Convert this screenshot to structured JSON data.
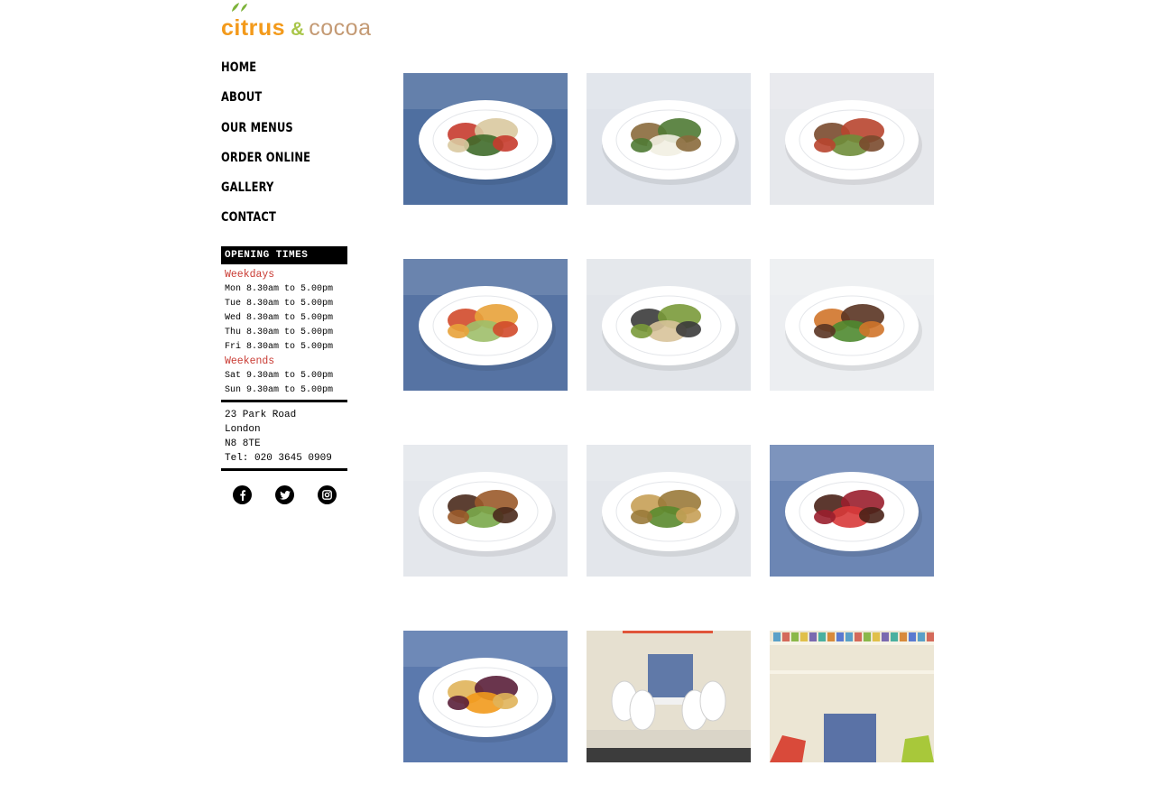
{
  "brand": {
    "part1": "citrus",
    "amp": "&",
    "part2": "cocoa",
    "colors": {
      "citrus": "#f39a1b",
      "amp": "#a9c64a",
      "cocoa": "#c49a74"
    }
  },
  "nav": {
    "items": [
      {
        "label": "HOME"
      },
      {
        "label": "ABOUT"
      },
      {
        "label": "OUR MENUS"
      },
      {
        "label": "ORDER ONLINE"
      },
      {
        "label": "GALLERY"
      },
      {
        "label": "CONTACT"
      }
    ]
  },
  "opening_times": {
    "title": "OPENING TIMES",
    "weekdays_label": "Weekdays",
    "weekdays": [
      "Mon 8.30am to 5.00pm",
      "Tue 8.30am to 5.00pm",
      "Wed 8.30am to 5.00pm",
      "Thu 8.30am to 5.00pm",
      "Fri 8.30am to 5.00pm"
    ],
    "weekends_label": "Weekends",
    "weekends": [
      "Sat 9.30am to 5.00pm",
      "Sun 9.30am to 5.00pm"
    ],
    "accent_color": "#c93a32"
  },
  "address": {
    "line1": "23 Park Road",
    "line2": "London",
    "line3": "N8 8TE",
    "tel": "Tel: 020 3645 0909"
  },
  "social": [
    {
      "icon": "facebook-icon",
      "glyph": "f"
    },
    {
      "icon": "twitter-icon",
      "glyph": "t"
    },
    {
      "icon": "instagram-icon",
      "glyph": "◎"
    }
  ],
  "gallery": {
    "photos": [
      {
        "name": "chickpea-salad-photo",
        "bg": "#4f6fa0",
        "plate": "#ffffff",
        "food": [
          "#c63b2e",
          "#d9c9a0",
          "#3f6b2a"
        ]
      },
      {
        "name": "lentil-feta-salad-photo",
        "bg": "#dfe3ea",
        "plate": "#ffffff",
        "food": [
          "#8a6a3c",
          "#4f7a34",
          "#f2efe2"
        ]
      },
      {
        "name": "meat-salad-photo",
        "bg": "#e6e8ec",
        "plate": "#ffffff",
        "food": [
          "#7a4a2e",
          "#b8452f",
          "#6f8d3a"
        ]
      },
      {
        "name": "tomato-bean-salad-photo",
        "bg": "#5673a3",
        "plate": "#ffffff",
        "food": [
          "#d24a2b",
          "#e8a23a",
          "#9fbf6a"
        ]
      },
      {
        "name": "seared-tuna-photo",
        "bg": "#e2e5ea",
        "plate": "#ffffff",
        "food": [
          "#3b3b3b",
          "#7a9a3a",
          "#d8c39a"
        ]
      },
      {
        "name": "sweet-potato-beef-photo",
        "bg": "#eceef1",
        "plate": "#ffffff",
        "food": [
          "#d0742a",
          "#5a3422",
          "#4f8a30"
        ]
      },
      {
        "name": "glazed-chicken-bowl-photo",
        "bg": "#e4e7ec",
        "plate": "#ffffff",
        "food": [
          "#4a2a1c",
          "#9a5a2a",
          "#7aa84a"
        ]
      },
      {
        "name": "halloumi-grain-salad-photo",
        "bg": "#e3e6eb",
        "plate": "#ffffff",
        "food": [
          "#c7a056",
          "#9a7a3a",
          "#5a8a2e"
        ]
      },
      {
        "name": "chocolate-brownie-photo",
        "bg": "#6c86b4",
        "plate": "#ffffff",
        "food": [
          "#4a2218",
          "#9a1f2e",
          "#d83a3a"
        ]
      },
      {
        "name": "orange-polenta-cake-photo",
        "bg": "#5b79ad",
        "plate": "#ffffff",
        "food": [
          "#e0b45a",
          "#5a1f3a",
          "#f29a1c"
        ]
      },
      {
        "name": "dining-table-photo",
        "bg": "#dad5c8",
        "plate": "#f4f4f4",
        "food": [
          "#6079a8",
          "#ffffff",
          "#c8c8c8"
        ]
      },
      {
        "name": "interior-shelves-photo",
        "bg": "#ece6d4",
        "plate": "#f7f3e8",
        "food": [
          "#5a72a6",
          "#d94a3a",
          "#a8c83a"
        ]
      }
    ]
  }
}
